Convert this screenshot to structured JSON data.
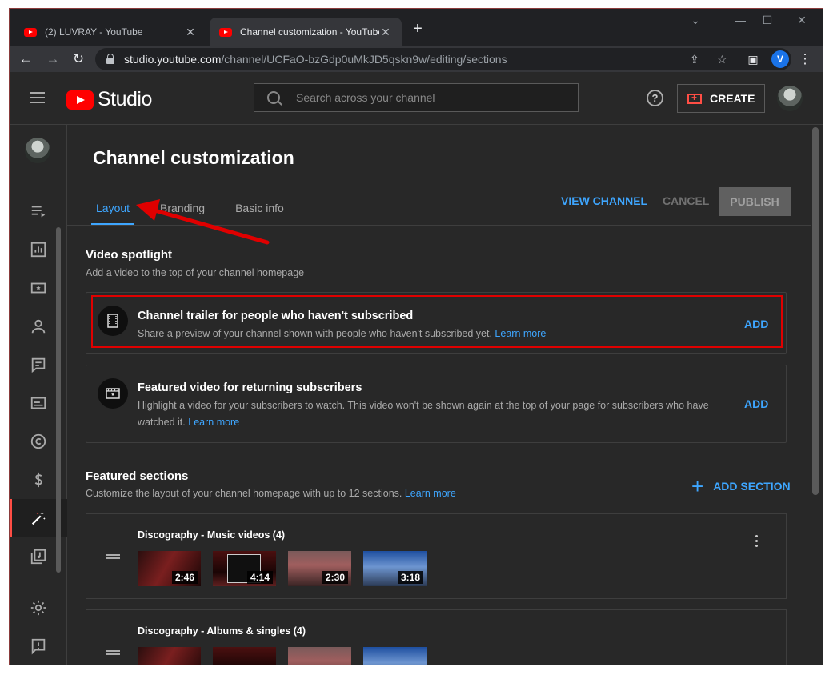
{
  "browser": {
    "tabs": [
      {
        "title": "(2) LUVRAY - YouTube",
        "active": false
      },
      {
        "title": "Channel customization - YouTube",
        "active": true
      }
    ],
    "url_host": "studio.youtube.com",
    "url_path": "/channel/UCFaO-bzGdp0uMkJD5qskn9w/editing/sections",
    "profile_initial": "V"
  },
  "header": {
    "logo_text": "Studio",
    "search_placeholder": "Search across your channel",
    "help_label": "?",
    "create_label": "CREATE"
  },
  "page": {
    "title": "Channel customization",
    "tabs": [
      {
        "label": "Layout",
        "active": true
      },
      {
        "label": "Branding",
        "active": false
      },
      {
        "label": "Basic info",
        "active": false
      }
    ],
    "view_channel": "VIEW CHANNEL",
    "cancel": "CANCEL",
    "publish": "PUBLISH"
  },
  "spotlight": {
    "title": "Video spotlight",
    "subtitle": "Add a video to the top of your channel homepage",
    "cards": [
      {
        "title": "Channel trailer for people who haven't subscribed",
        "description": "Share a preview of your channel shown with people who haven't subscribed yet.",
        "link": "Learn more",
        "action": "ADD"
      },
      {
        "title": "Featured video for returning subscribers",
        "description": "Highlight a video for your subscribers to watch. This video won't be shown again at the top of your page for subscribers who have watched it.",
        "link": "Learn more",
        "action": "ADD"
      }
    ]
  },
  "featured": {
    "title": "Featured sections",
    "subtitle": "Customize the layout of your channel homepage with up to 12 sections.",
    "link": "Learn more",
    "add_section": "ADD SECTION",
    "sections": [
      {
        "title": "Discography - Music videos (4)",
        "durations": [
          "2:46",
          "4:14",
          "2:30",
          "3:18"
        ]
      },
      {
        "title": "Discography - Albums & singles (4)"
      }
    ]
  },
  "colors": {
    "accent": "#3ea6ff",
    "brand_red": "#ff0000",
    "annotation_red": "#e00000"
  }
}
